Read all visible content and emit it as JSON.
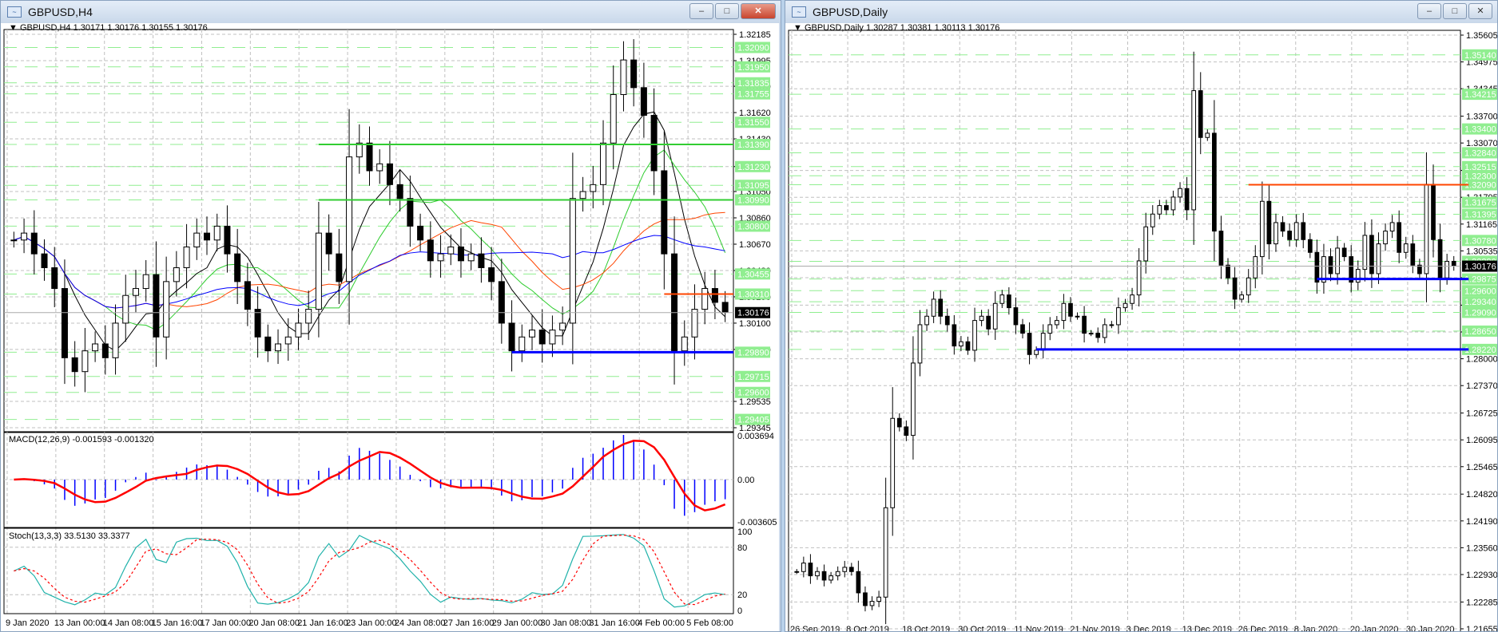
{
  "left": {
    "window_title": "GBPUSD,H4",
    "chart_label": "GBPUSD,H4  1.30171 1.30176 1.30155 1.30176",
    "macd_label": "MACD(12,26,9) -0.001593 -0.001320",
    "stoch_label": "Stoch(13,3,3) 33.5130 33.3377",
    "buttons": {
      "minimize": "–",
      "maximize": "□",
      "close": "✕"
    },
    "price_range": [
      1.29345,
      1.32185
    ],
    "axis_ticks": [
      "1.32185",
      "1.31995",
      "1.31810",
      "1.31620",
      "1.31430",
      "1.31230",
      "1.31050",
      "1.30860",
      "1.30670",
      "1.30480",
      "1.30290",
      "1.30100",
      "1.29910",
      "1.29535",
      "1.29345"
    ],
    "level_labels": [
      "1.32090",
      "1.31950",
      "1.31835",
      "1.31755",
      "1.31550",
      "1.31390",
      "1.31230",
      "1.31095",
      "1.30990",
      "1.30800",
      "1.30455",
      "1.30310",
      "1.29890",
      "1.29715",
      "1.29600",
      "1.29405"
    ],
    "current_price": "1.30176",
    "macd_axis": [
      "0.003694",
      "0.00",
      "-0.003605"
    ],
    "stoch_axis": [
      "100",
      "80",
      "20",
      "0"
    ],
    "date_labels": [
      "9 Jan 2020",
      "13 Jan 00:00",
      "14 Jan 08:00",
      "15 Jan 16:00",
      "17 Jan 00:00",
      "20 Jan 08:00",
      "21 Jan 16:00",
      "23 Jan 00:00",
      "24 Jan 08:00",
      "27 Jan 16:00",
      "29 Jan 00:00",
      "30 Jan 08:00",
      "31 Jan 16:00",
      "4 Feb 00:00",
      "5 Feb 08:00"
    ],
    "lines": {
      "green_upper": 1.3139,
      "green_lower": 1.3099,
      "red_resistance": 1.3031,
      "blue_support": 1.2989
    },
    "closes": [
      1.307,
      1.3075,
      1.306,
      1.305,
      1.3035,
      1.2985,
      1.2975,
      1.299,
      1.2995,
      1.2985,
      1.301,
      1.303,
      1.3035,
      1.3045,
      1.3,
      1.304,
      1.305,
      1.3065,
      1.3075,
      1.307,
      1.308,
      1.306,
      1.304,
      1.302,
      1.3,
      1.299,
      1.2995,
      1.3,
      1.301,
      1.302,
      1.3075,
      1.306,
      1.304,
      1.313,
      1.314,
      1.312,
      1.3125,
      1.311,
      1.31,
      1.308,
      1.307,
      1.3055,
      1.306,
      1.3065,
      1.3055,
      1.306,
      1.305,
      1.304,
      1.301,
      1.299,
      1.3,
      1.3005,
      1.2995,
      1.3005,
      1.301,
      1.31,
      1.3105,
      1.311,
      1.314,
      1.3175,
      1.32,
      1.318,
      1.316,
      1.312,
      1.306,
      1.299,
      1.3,
      1.302,
      1.3035,
      1.3025,
      1.3018
    ]
  },
  "right": {
    "window_title": "GBPUSD,Daily",
    "chart_label": "GBPUSD,Daily  1.30287 1.30381 1.30113 1.30176",
    "buttons": {
      "minimize": "–",
      "maximize": "□",
      "close": "✕"
    },
    "price_range": [
      1.21655,
      1.35605
    ],
    "axis_ticks": [
      "1.35605",
      "1.34975",
      "1.34345",
      "1.33700",
      "1.33070",
      "1.32425",
      "1.31795",
      "1.31165",
      "1.30535",
      "1.29905",
      "1.29260",
      "1.28630",
      "1.28000",
      "1.27370",
      "1.26725",
      "1.26095",
      "1.25465",
      "1.24820",
      "1.24190",
      "1.23560",
      "1.22930",
      "1.22285",
      "1.21655"
    ],
    "level_labels": [
      "1.35140",
      "1.34215",
      "1.33400",
      "1.32840",
      "1.32515",
      "1.32300",
      "1.32090",
      "1.31675",
      "1.31395",
      "1.30780",
      "1.30290",
      "1.29875",
      "1.29600",
      "1.29340",
      "1.29090",
      "1.28650",
      "1.28220"
    ],
    "current_price": "1.30176",
    "date_labels": [
      "26 Sep 2019",
      "8 Oct 2019",
      "18 Oct 2019",
      "30 Oct 2019",
      "11 Nov 2019",
      "21 Nov 2019",
      "3 Dec 2019",
      "13 Dec 2019",
      "26 Dec 2019",
      "8 Jan 2020",
      "20 Jan 2020",
      "30 Jan 2020"
    ],
    "lines": {
      "red_resistance": 1.3209,
      "blue_support_upper": 1.29875,
      "blue_support_lower": 1.2822
    },
    "closes": [
      1.23,
      1.232,
      1.229,
      1.23,
      1.228,
      1.229,
      1.23,
      1.231,
      1.23,
      1.225,
      1.222,
      1.223,
      1.224,
      1.245,
      1.266,
      1.264,
      1.262,
      1.279,
      1.288,
      1.29,
      1.294,
      1.29,
      1.288,
      1.283,
      1.284,
      1.282,
      1.289,
      1.29,
      1.287,
      1.293,
      1.295,
      1.292,
      1.288,
      1.286,
      1.281,
      1.282,
      1.286,
      1.288,
      1.289,
      1.293,
      1.29,
      1.29,
      1.286,
      1.286,
      1.285,
      1.288,
      1.288,
      1.292,
      1.293,
      1.295,
      1.303,
      1.311,
      1.314,
      1.316,
      1.315,
      1.318,
      1.32,
      1.315,
      1.343,
      1.332,
      1.333,
      1.31,
      1.302,
      1.299,
      1.294,
      1.295,
      1.299,
      1.304,
      1.317,
      1.307,
      1.312,
      1.31,
      1.308,
      1.312,
      1.308,
      1.305,
      1.298,
      1.304,
      1.3,
      1.306,
      1.304,
      1.298,
      1.301,
      1.309,
      1.3,
      1.307,
      1.31,
      1.312,
      1.305,
      1.307,
      1.302,
      1.3,
      1.321,
      1.308,
      1.299,
      1.3029,
      1.3018
    ]
  },
  "colors": {
    "level_label_bg": "#90ee90",
    "grid": "#c0c0c0",
    "green_line": "#32cd32",
    "red_line": "#ff4500",
    "blue_line": "#0000ff",
    "macd_hist": "#0000ff",
    "macd_signal": "#ff0000",
    "stoch_main": "#20b2aa",
    "stoch_signal": "#ff0000"
  }
}
